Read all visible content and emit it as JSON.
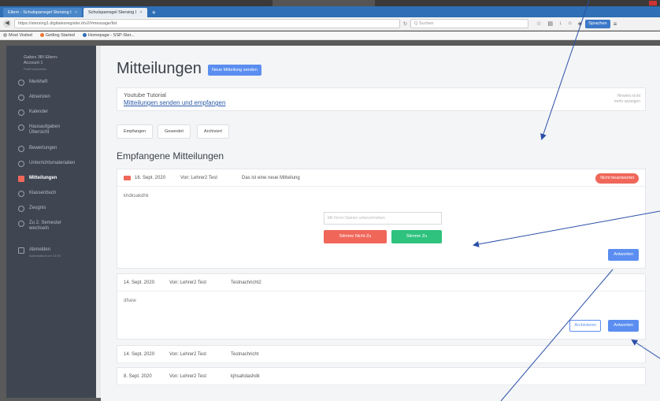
{
  "browser": {
    "tabs": [
      {
        "label": "Eltern - Schulsparregel Stersing I"
      },
      {
        "label": "Schulsparregel Stersing I"
      }
    ],
    "url": "https://stersing1.digitalesregister.it/v2/#message/list",
    "search_placeholder": "Q Suchen",
    "language_button": "Sprachen",
    "bookmarks": [
      "Most Visited",
      "Getting Started",
      "Homepage - SSP-Ster..."
    ]
  },
  "sidebar": {
    "user_name": "Gabes 3BI Eltern-Account 1",
    "user_sub": "Profil bearbeiten",
    "items": [
      {
        "label": "Merkheft",
        "sub": ""
      },
      {
        "label": "Absenzen",
        "sub": ""
      },
      {
        "label": "Kalender",
        "sub": ""
      },
      {
        "label": "Hausaufgaben Übersicht",
        "sub": ""
      },
      {
        "label": "Bewertungen",
        "sub": ""
      },
      {
        "label": "Unterrichtsmaterialien",
        "sub": ""
      },
      {
        "label": "Mitteilungen",
        "sub": ""
      },
      {
        "label": "Klassenbuch",
        "sub": ""
      },
      {
        "label": "Zeugnis",
        "sub": ""
      },
      {
        "label": "Zu 2. Semester wechseln",
        "sub": ""
      },
      {
        "label": "Abmelden",
        "sub": "Automatisch um 13:00"
      }
    ]
  },
  "main": {
    "title": "Mitteilungen",
    "new_message_button": "Neue Mitteilung senden",
    "tutorial": {
      "heading": "Youtube Tutorial",
      "link": "Mitteilungen senden und empfangen",
      "hide": "Hinweis nicht mehr anzeigen"
    },
    "filters": [
      "Empfangen",
      "Gesendet",
      "Archiviert"
    ],
    "section_title": "Empfangene Mitteilungen",
    "messages": [
      {
        "date": "16. Sept. 2020",
        "from": "Von: Lehrer2 Test",
        "subject": "Das ist eine neue Mitteilung",
        "status": "Nicht beantwortet",
        "body": "khdksakdhk",
        "reason_placeholder": "Mit Ihrem Namen unterschreiben",
        "decline": "Stimme Nicht Zu",
        "accept": "Stimme Zu",
        "reply": "Antworten"
      },
      {
        "date": "14. Sept. 2020",
        "from": "Von: Lehrer2 Test",
        "subject": "Testnachricht2",
        "body": "dfsew",
        "archive": "Archivieren",
        "reply": "Antworten"
      },
      {
        "date": "14. Sept. 2020",
        "from": "Von: Lehrer2 Test",
        "subject": "Testnachricht"
      },
      {
        "date": "8. Sept. 2020",
        "from": "Von: Lehrer2 Test",
        "subject": "kjhsahdashdk"
      }
    ]
  },
  "colors": {
    "accent": "#5b8ef0",
    "danger": "#f0675a",
    "success": "#2ec27e",
    "sidebar": "#3f4652",
    "annotation": "#2a4fa8"
  }
}
